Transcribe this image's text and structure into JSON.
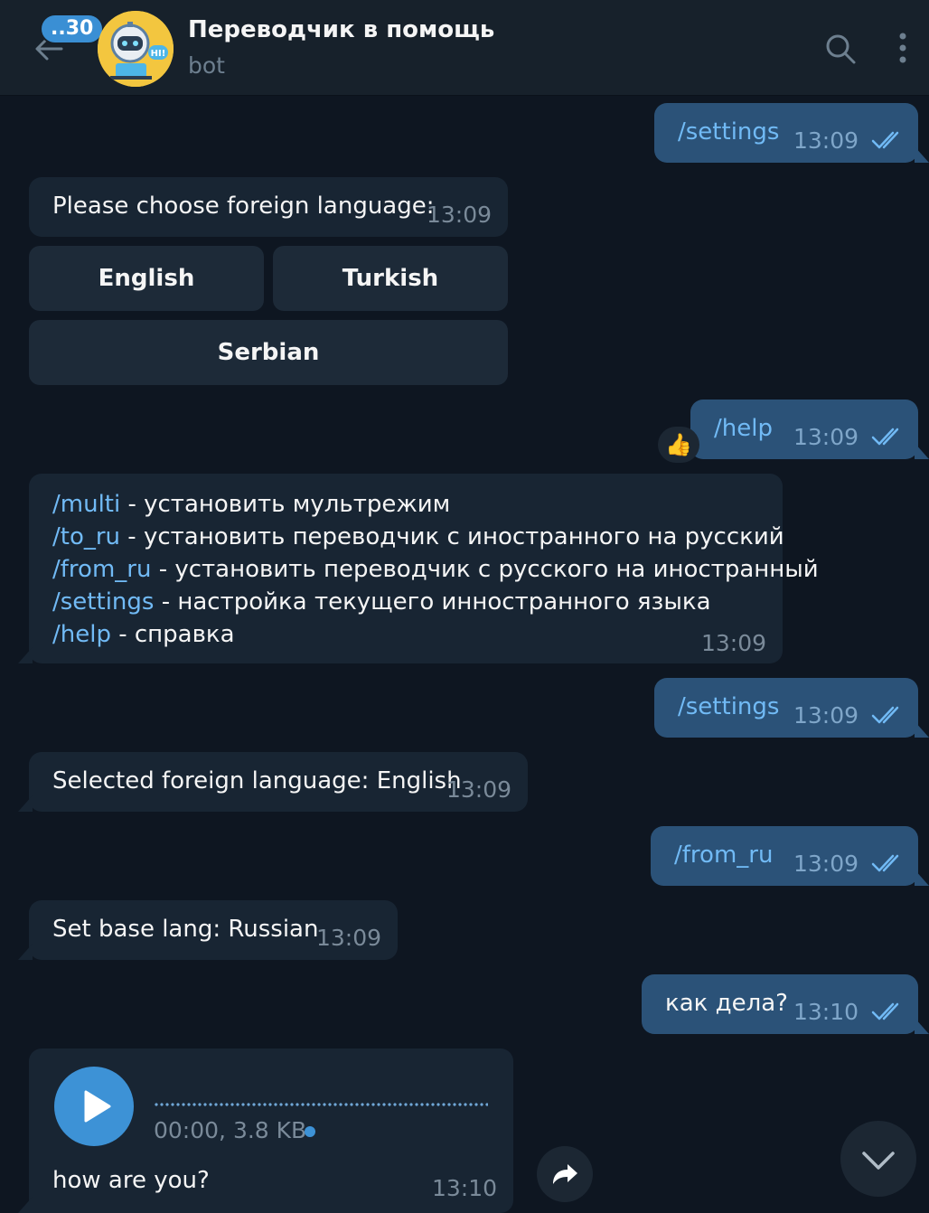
{
  "header": {
    "unread_count": "..30",
    "title": "Переводчик в помощь",
    "subtitle": "bot",
    "avatar_label": "HI!"
  },
  "messages": {
    "m1": {
      "text": "/settings",
      "time": "13:09"
    },
    "m2": {
      "text": "Please choose foreign language:",
      "time": "13:09"
    },
    "keyboard": {
      "english": "English",
      "turkish": "Turkish",
      "serbian": "Serbian"
    },
    "m3": {
      "text": "/help",
      "time": "13:09",
      "reaction": "👍"
    },
    "m4": {
      "lines": [
        {
          "cmd": "/multi",
          "desc": " - установить мультрежим"
        },
        {
          "cmd": "/to_ru",
          "desc": " - установить переводчик с иностранного на русский"
        },
        {
          "cmd": "/from_ru",
          "desc": " - установить переводчик с русского на иностранный"
        },
        {
          "cmd": "/settings",
          "desc": " - настройка текущего инностранного языка"
        },
        {
          "cmd": "/help",
          "desc": " - справка"
        }
      ],
      "time": "13:09"
    },
    "m5": {
      "text": "/settings",
      "time": "13:09"
    },
    "m6": {
      "text": "Selected foreign language: English",
      "time": "13:09"
    },
    "m7": {
      "text": "/from_ru",
      "time": "13:09"
    },
    "m8": {
      "text": "Set base lang: Russian",
      "time": "13:09"
    },
    "m9": {
      "text": "как дела?",
      "time": "13:10"
    },
    "m10": {
      "voice_meta": "00:00, 3.8 KB",
      "caption": "how are you?",
      "time": "13:10"
    }
  },
  "colors": {
    "background": "#0e1621",
    "header": "#17212b",
    "outgoing_bubble": "#2b5278",
    "incoming_bubble": "#182533",
    "link": "#71baf5",
    "accent": "#3d92d6"
  },
  "icons": [
    "back-arrow-icon",
    "search-icon",
    "more-vertical-icon",
    "double-check-icon",
    "play-icon",
    "forward-icon",
    "chevron-down-icon"
  ]
}
